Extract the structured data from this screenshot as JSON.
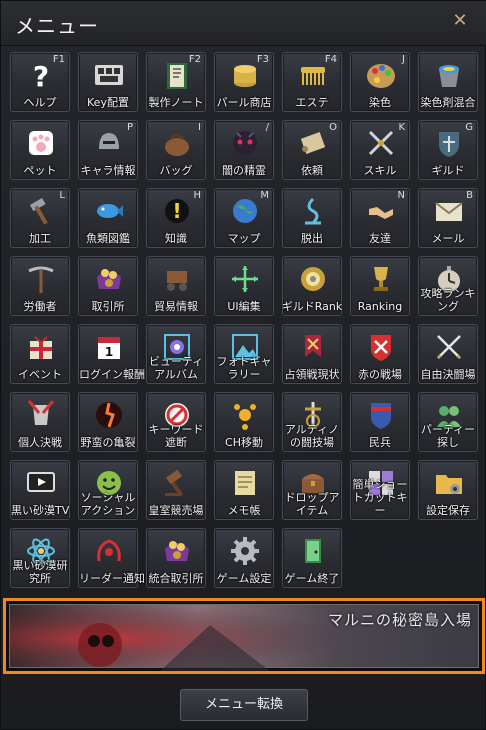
{
  "window": {
    "title": "メニュー",
    "close_icon": "close-icon"
  },
  "items": [
    {
      "label": "ヘルプ",
      "key": "F1",
      "icon": "question-icon"
    },
    {
      "label": "Key配置",
      "key": "",
      "icon": "keyboard-icon"
    },
    {
      "label": "製作ノート",
      "key": "F2",
      "icon": "book-icon"
    },
    {
      "label": "パール商店",
      "key": "F3",
      "icon": "coins-icon"
    },
    {
      "label": "エステ",
      "key": "F4",
      "icon": "comb-icon"
    },
    {
      "label": "染色",
      "key": "J",
      "icon": "palette-icon"
    },
    {
      "label": "染色剤混合",
      "key": "",
      "icon": "bucket-icon"
    },
    {
      "label": "ペット",
      "key": "",
      "icon": "paw-icon"
    },
    {
      "label": "キャラ情報",
      "key": "P",
      "icon": "helmet-icon"
    },
    {
      "label": "バッグ",
      "key": "I",
      "icon": "bag-icon"
    },
    {
      "label": "闇の精霊",
      "key": "/",
      "icon": "spirit-icon"
    },
    {
      "label": "依頼",
      "key": "O",
      "icon": "scroll-icon"
    },
    {
      "label": "スキル",
      "key": "K",
      "icon": "swords-icon"
    },
    {
      "label": "ギルド",
      "key": "G",
      "icon": "guild-shield-icon"
    },
    {
      "label": "加工",
      "key": "L",
      "icon": "hammer-icon"
    },
    {
      "label": "魚類図鑑",
      "key": "",
      "icon": "fish-icon"
    },
    {
      "label": "知識",
      "key": "H",
      "icon": "knowledge-icon"
    },
    {
      "label": "マップ",
      "key": "M",
      "icon": "globe-icon"
    },
    {
      "label": "脱出",
      "key": "",
      "icon": "escape-icon"
    },
    {
      "label": "友達",
      "key": "N",
      "icon": "handshake-icon"
    },
    {
      "label": "メール",
      "key": "B",
      "icon": "mail-icon"
    },
    {
      "label": "労働者",
      "key": "",
      "icon": "pickaxe-icon"
    },
    {
      "label": "取引所",
      "key": "",
      "icon": "treasure-icon"
    },
    {
      "label": "貿易情報",
      "key": "",
      "icon": "cart-icon"
    },
    {
      "label": "UI編集",
      "key": "",
      "icon": "move-icon"
    },
    {
      "label": "ギルドRank",
      "key": "",
      "icon": "laurel-icon"
    },
    {
      "label": "Ranking",
      "key": "",
      "icon": "trophy-icon"
    },
    {
      "label": "攻略ランキング",
      "key": "",
      "icon": "stopwatch-icon"
    },
    {
      "label": "イベント",
      "key": "",
      "icon": "gift-icon"
    },
    {
      "label": "ログイン報酬",
      "key": "",
      "icon": "calendar-icon"
    },
    {
      "label": "ビューティアルバム",
      "key": "",
      "icon": "album-icon"
    },
    {
      "label": "フォトギャラリー",
      "key": "",
      "icon": "photo-icon"
    },
    {
      "label": "占領戦現状",
      "key": "",
      "icon": "banner-icon"
    },
    {
      "label": "赤の戦場",
      "key": "",
      "icon": "red-battle-icon"
    },
    {
      "label": "自由決闘場",
      "key": "",
      "icon": "crossed-swords-icon"
    },
    {
      "label": "個人決戦",
      "key": "",
      "icon": "knight-icon"
    },
    {
      "label": "野蛮の亀裂",
      "key": "",
      "icon": "rift-icon"
    },
    {
      "label": "キーワード遮断",
      "key": "",
      "icon": "block-icon"
    },
    {
      "label": "CH移動",
      "key": "",
      "icon": "channel-icon"
    },
    {
      "label": "アルティノの闘技場",
      "key": "",
      "icon": "arena-icon"
    },
    {
      "label": "民兵",
      "key": "",
      "icon": "militia-icon"
    },
    {
      "label": "パーティー探し",
      "key": "",
      "icon": "party-icon"
    },
    {
      "label": "黒い砂漠TV",
      "key": "",
      "icon": "tv-icon"
    },
    {
      "label": "ソーシャルアクション",
      "key": "",
      "icon": "smile-icon"
    },
    {
      "label": "皇室競売場",
      "key": "",
      "icon": "gavel-icon"
    },
    {
      "label": "メモ帳",
      "key": "",
      "icon": "notepad-icon"
    },
    {
      "label": "ドロップアイテム",
      "key": "",
      "icon": "drop-chest-icon"
    },
    {
      "label": "簡単ショートカットキー",
      "key": "",
      "icon": "shortcut-icon"
    },
    {
      "label": "設定保存",
      "key": "",
      "icon": "folder-gear-icon"
    },
    {
      "label": "黒い砂漠研究所",
      "key": "",
      "icon": "atom-icon"
    },
    {
      "label": "リーダー通知",
      "key": "",
      "icon": "leader-icon"
    },
    {
      "label": "統合取引所",
      "key": "",
      "icon": "treasure-icon"
    },
    {
      "label": "ゲーム設定",
      "key": "",
      "icon": "gear-icon"
    },
    {
      "label": "ゲーム終了",
      "key": "",
      "icon": "exit-door-icon"
    }
  ],
  "banner": {
    "text": "マルニの秘密島入場"
  },
  "footer": {
    "convert_label": "メニュー転換"
  },
  "colors": {
    "banner_border": "#f08a1c",
    "key_hint": "#dcdcdc"
  }
}
